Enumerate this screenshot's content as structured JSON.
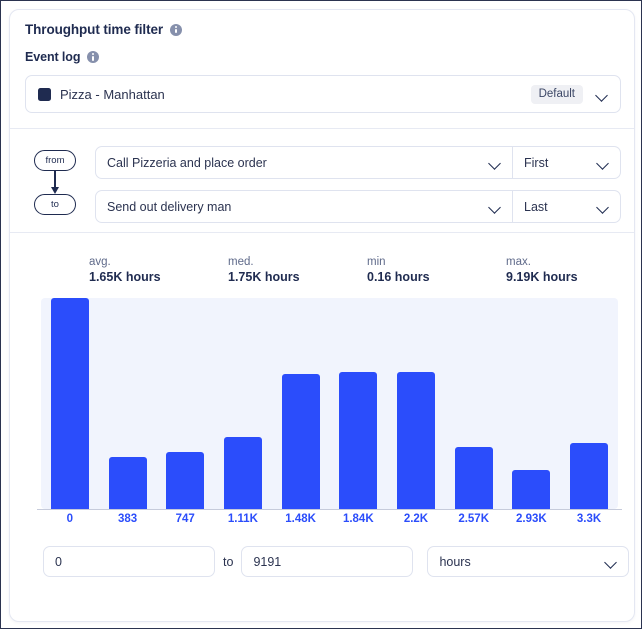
{
  "header": {
    "title": "Throughput time filter",
    "info_icon": "info-icon",
    "sub_label": "Event log",
    "sub_info_icon": "info-icon"
  },
  "event_log": {
    "swatch_icon": "color-swatch-icon",
    "name": "Pizza - Manhattan",
    "badge": "Default",
    "chevron_icon": "chevron-down-icon"
  },
  "from_to": {
    "from_pill": "from",
    "to_pill": "to",
    "arrow_icon": "arrow-down-icon",
    "rows": [
      {
        "activity": "Call Pizzeria and place order",
        "occurrence": "First"
      },
      {
        "activity": "Send out delivery man",
        "occurrence": "Last"
      }
    ],
    "chevron_icon": "chevron-down-icon"
  },
  "stats": [
    {
      "label": "avg.",
      "value": "1.65K hours"
    },
    {
      "label": "med.",
      "value": "1.75K hours"
    },
    {
      "label": "min",
      "value": "0.16 hours"
    },
    {
      "label": "max.",
      "value": "9.19K hours"
    }
  ],
  "range": {
    "min_value": "0",
    "min_placeholder": "0",
    "to_label": "to",
    "max_value": "9191",
    "max_placeholder": "9191",
    "unit": "hours",
    "chevron_icon": "chevron-down-icon"
  },
  "chart_data": {
    "type": "bar",
    "title": "",
    "xlabel": "",
    "ylabel": "",
    "grid": false,
    "legend": "none",
    "bar_color": "#2b4dfb",
    "plot_background": "#f1f4fd",
    "axis_tick_color": "#2b4dfb",
    "categories": [
      "0",
      "383",
      "747",
      "1.11K",
      "1.48K",
      "1.84K",
      "2.2K",
      "2.57K",
      "2.93K",
      "3.3K"
    ],
    "values": [
      211,
      52,
      57,
      72,
      135,
      137,
      137,
      62,
      39,
      66
    ],
    "ylim": [
      0,
      211
    ]
  }
}
